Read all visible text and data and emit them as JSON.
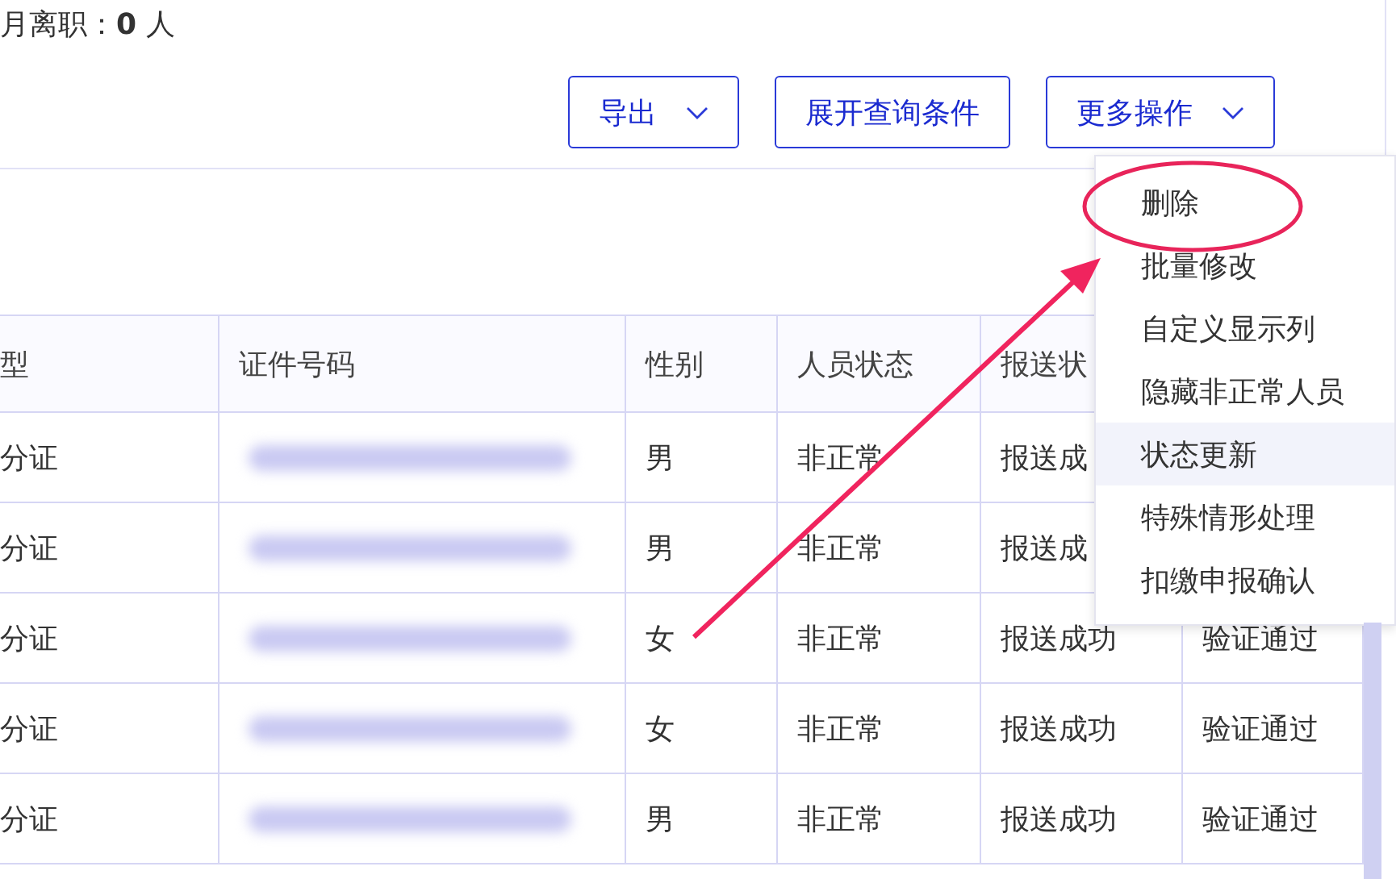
{
  "summary": "月离职：**0** 人",
  "buttons": [
    {
      "label": "导出",
      "dropdown": true
    },
    {
      "label": "展开查询条件",
      "dropdown": false
    },
    {
      "label": "更多操作",
      "dropdown": true
    }
  ],
  "table": {
    "columns": [
      "型",
      "证件号码",
      "性别",
      "人员状态",
      "报送状"
    ],
    "rows": [
      {
        "type": "分证",
        "gender": "男",
        "status": "非正常",
        "report": "报送成"
      },
      {
        "type": "分证",
        "gender": "男",
        "status": "非正常",
        "report": "报送成"
      },
      {
        "type": "分证",
        "gender": "女",
        "status": "非正常",
        "report": "报送成功",
        "verify": "验证通过"
      },
      {
        "type": "分证",
        "gender": "女",
        "status": "非正常",
        "report": "报送成功",
        "verify": "验证通过"
      },
      {
        "type": "分证",
        "gender": "男",
        "status": "非正常",
        "report": "报送成功",
        "verify": "验证通过"
      }
    ]
  },
  "menu": {
    "items": [
      {
        "label": "删除",
        "hovered": false,
        "circled": true
      },
      {
        "label": "批量修改",
        "hovered": false,
        "circled": false
      },
      {
        "label": "自定义显示列",
        "hovered": false,
        "circled": false
      },
      {
        "label": "隐藏非正常人员",
        "hovered": false,
        "circled": false
      },
      {
        "label": "状态更新",
        "hovered": true,
        "circled": false
      },
      {
        "label": "特殊情形处理",
        "hovered": false,
        "circled": false
      },
      {
        "label": "扣缴申报确认",
        "hovered": false,
        "circled": false
      }
    ]
  }
}
